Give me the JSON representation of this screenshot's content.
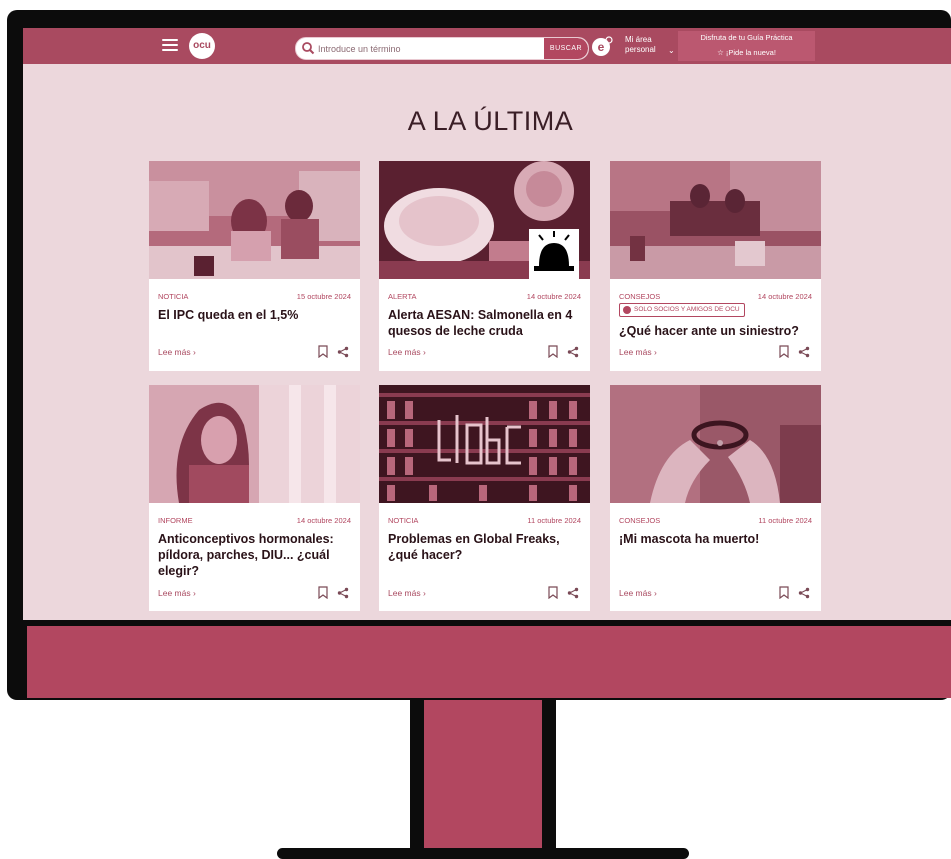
{
  "header": {
    "search_placeholder": "Introduce un término",
    "search_button": "BUSCAR",
    "area_line1": "Mi área",
    "area_line2": "personal",
    "promo_line1": "Disfruta de tu Guía Práctica",
    "promo_line2": "☆ ¡Pide la nueva!"
  },
  "logo_text": "ocu",
  "section_title": "A LA ÚLTIMA",
  "cards": [
    {
      "category": "NOTICIA",
      "date": "15 octubre 2024",
      "title": "El IPC queda en el 1,5%",
      "read_more": "Lee más ›"
    },
    {
      "category": "ALERTA",
      "date": "14 octubre 2024",
      "title": "Alerta AESAN: Salmonella en 4 quesos de leche cruda",
      "read_more": "Lee más ›"
    },
    {
      "category": "CONSEJOS",
      "date": "14 octubre 2024",
      "badge": "SOLO SOCIOS Y AMIGOS DE OCU",
      "title": "¿Qué hacer ante un siniestro?",
      "read_more": "Lee más ›"
    },
    {
      "category": "INFORME",
      "date": "14 octubre 2024",
      "title": "Anticonceptivos hormonales: píldora, parches, DIU... ¿cuál elegir?",
      "read_more": "Lee más ›"
    },
    {
      "category": "NOTICIA",
      "date": "11 octubre 2024",
      "title": "Problemas en Global Freaks, ¿qué hacer?",
      "read_more": "Lee más ›"
    },
    {
      "category": "CONSEJOS",
      "date": "11 octubre 2024",
      "title": "¡Mi mascota ha muerto!",
      "read_more": "Lee más ›"
    }
  ],
  "colors": {
    "brand": "#b24760",
    "header": "#a94a60",
    "screen_bg": "#ecd7dc",
    "frame": "#0c0c0c"
  },
  "icons": [
    "menu-icon",
    "search-icon",
    "e-icon",
    "bookmark-icon",
    "share-icon",
    "alarm-siren-icon",
    "lock-icon"
  ]
}
